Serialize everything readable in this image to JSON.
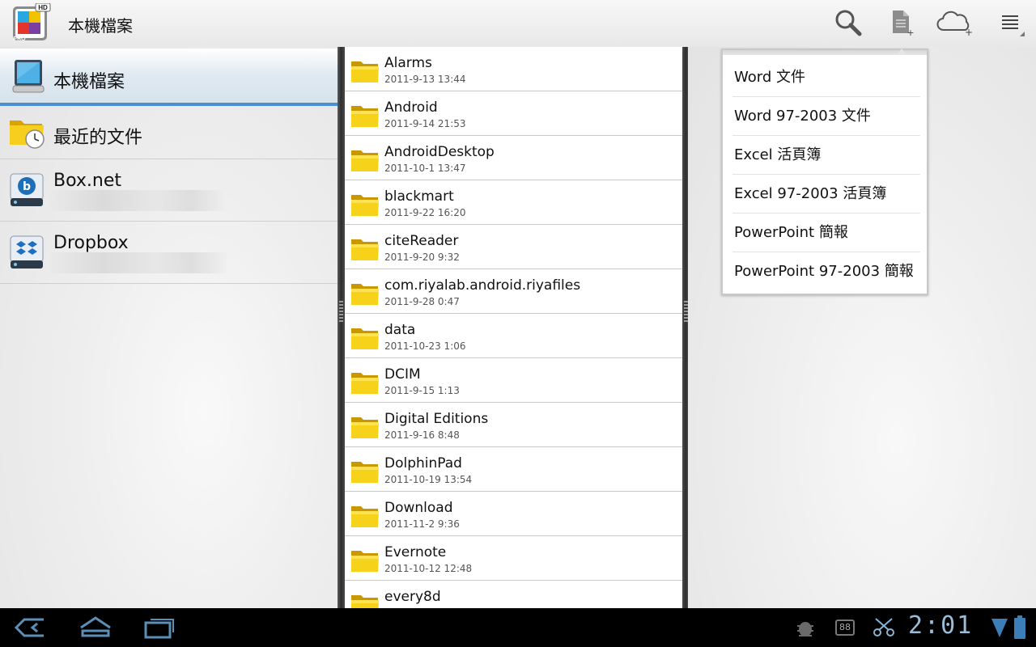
{
  "action_bar": {
    "title": "本機檔案",
    "app_icon": "quickoffice-pro-hd-icon",
    "app_icon_badge_top": "HD",
    "app_icon_badge_bottom": "PRO",
    "actions": [
      "search-icon",
      "new-document-icon",
      "cloud-add-icon",
      "menu-overflow-icon"
    ]
  },
  "nav": {
    "items": [
      {
        "label": "本機檔案",
        "icon": "tablet-icon",
        "selected": true
      },
      {
        "label": "最近的文件",
        "icon": "recent-folder-icon"
      },
      {
        "label": "Box.net",
        "icon": "box-drive-icon"
      },
      {
        "label": "Dropbox",
        "icon": "dropbox-drive-icon"
      }
    ]
  },
  "files": [
    {
      "name": "Alarms",
      "date": "2011-9-13 13:44"
    },
    {
      "name": "Android",
      "date": "2011-9-14 21:53"
    },
    {
      "name": "AndroidDesktop",
      "date": "2011-10-1 13:47"
    },
    {
      "name": "blackmart",
      "date": "2011-9-22 16:20"
    },
    {
      "name": "citeReader",
      "date": "2011-9-20 9:32"
    },
    {
      "name": "com.riyalab.android.riyafiles",
      "date": "2011-9-28 0:47"
    },
    {
      "name": "data",
      "date": "2011-10-23 1:06"
    },
    {
      "name": "DCIM",
      "date": "2011-9-15 1:13"
    },
    {
      "name": "Digital Editions",
      "date": "2011-9-16 8:48"
    },
    {
      "name": "DolphinPad",
      "date": "2011-10-19 13:54"
    },
    {
      "name": "Download",
      "date": "2011-11-2 9:36"
    },
    {
      "name": "Evernote",
      "date": "2011-10-12 12:48"
    },
    {
      "name": "every8d",
      "date": ""
    }
  ],
  "new_doc_menu": {
    "items": [
      "Word 文件",
      "Word 97-2003 文件",
      "Excel 活頁簿",
      "Excel 97-2003 活頁簿",
      "PowerPoint 簡報",
      "PowerPoint 97-2003 簡報"
    ]
  },
  "system_bar": {
    "time": "2:01",
    "battery_badge": "88",
    "buttons": [
      "back-icon",
      "home-icon",
      "recent-apps-icon"
    ],
    "status_icons": [
      "android-debug-icon",
      "battery-badge-icon",
      "scissors-icon",
      "signal-icon",
      "battery-icon"
    ]
  }
}
